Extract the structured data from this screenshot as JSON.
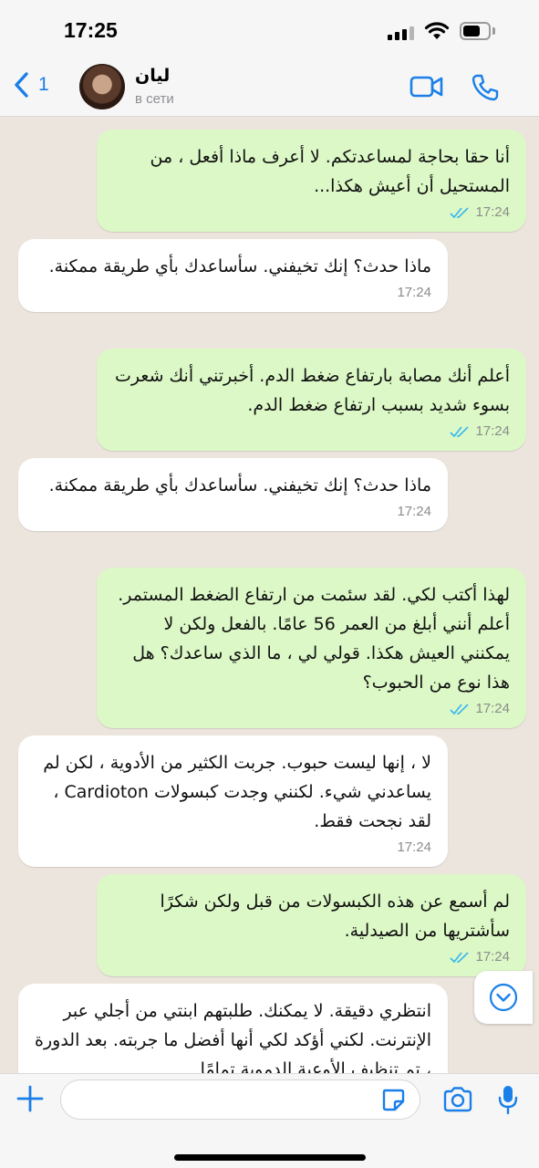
{
  "status_bar": {
    "time": "17:25"
  },
  "header": {
    "back_count": "1",
    "contact_name": "ليان",
    "contact_status": "в сети"
  },
  "messages": [
    {
      "direction": "out",
      "text": "أنا حقا بحاجة لمساعدتكم. لا أعرف ماذا أفعل ، من المستحيل أن أعيش هكذا...",
      "time": "17:24",
      "read": true
    },
    {
      "direction": "in",
      "text": "ماذا حدث؟ إنك تخيفني. سأساعدك بأي طريقة ممكنة.",
      "time": "17:24"
    },
    {
      "direction": "out",
      "text": "أعلم أنك مصابة بارتفاع ضغط الدم. أخبرتني أنك شعرت بسوء شديد بسبب ارتفاع ضغط الدم.",
      "time": "17:24",
      "read": true
    },
    {
      "direction": "in",
      "text": "ماذا حدث؟ إنك تخيفني. سأساعدك بأي طريقة ممكنة.",
      "time": "17:24"
    },
    {
      "direction": "out",
      "text": "لهذا أكتب لكي. لقد سئمت من ارتفاع الضغط المستمر. أعلم أنني أبلغ من العمر 56 عامًا. بالفعل ولكن لا يمكنني العيش هكذا. قولي لي ، ما الذي ساعدك؟ هل هذا نوع من الحبوب؟",
      "time": "17:24",
      "read": true
    },
    {
      "direction": "in",
      "text": "لا ، إنها ليست حبوب. جربت الكثير من الأدوية ، لكن لم يساعدني شيء. لكنني وجدت كبسولات Cardioton ، لقد نجحت فقط.",
      "time": "17:24"
    },
    {
      "direction": "out",
      "text": "لم أسمع عن هذه الكبسولات من قبل ولكن شكرًا سأشتريها من الصيدلية.",
      "time": "17:24",
      "read": true
    },
    {
      "direction": "in",
      "text": "انتظري دقيقة. لا يمكنك. طلبتهم ابنتي من أجلي عبر الإنترنت. لكني أؤكد لكي أنها أفضل ما جربته. بعد الدورة ، تم تنظيف الأوعية الدموية تمامًا",
      "time": ""
    }
  ],
  "input": {
    "placeholder": ""
  },
  "colors": {
    "accent": "#1a7fe8",
    "outgoing": "#dcf8c6",
    "incoming": "#ffffff",
    "read_ticks": "#34b7f1"
  }
}
